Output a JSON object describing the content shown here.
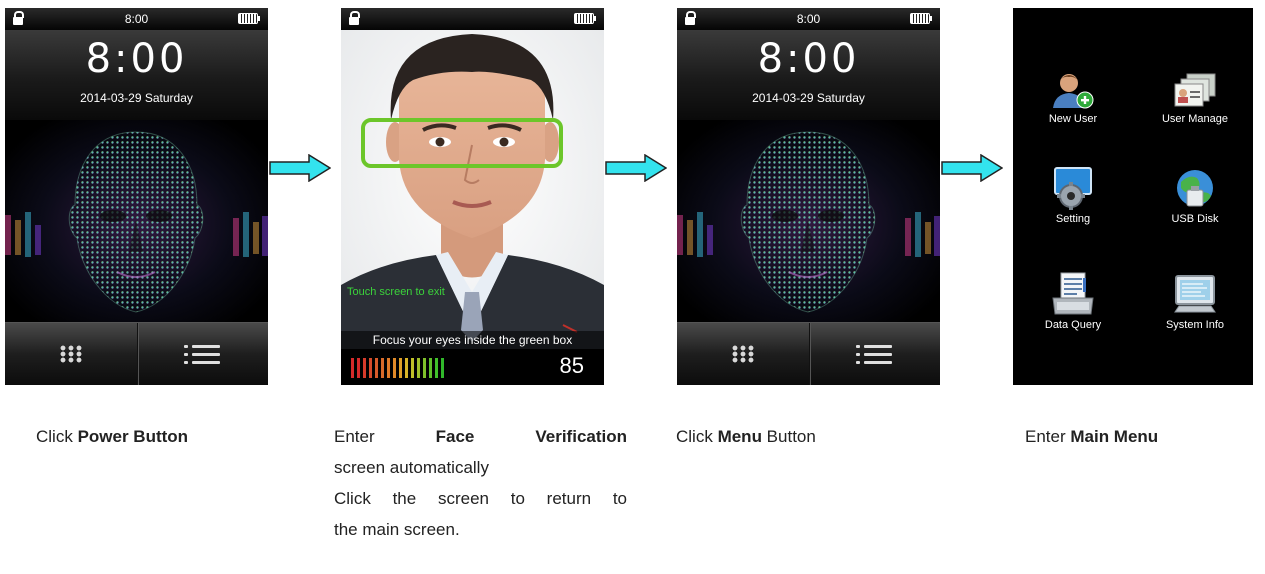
{
  "screens": {
    "lock": {
      "status_time": "8:00",
      "big_time": "8:00",
      "date": "2014-03-29  Saturday"
    },
    "verify": {
      "touch_hint": "Touch screen to exit",
      "focus_hint": "Focus your eyes inside the green box",
      "score": "85"
    },
    "menu": {
      "items": [
        {
          "label": "New User",
          "icon": "new-user-icon"
        },
        {
          "label": "User Manage",
          "icon": "user-manage-icon"
        },
        {
          "label": "Setting",
          "icon": "setting-icon"
        },
        {
          "label": "USB Disk",
          "icon": "usb-disk-icon"
        },
        {
          "label": "Data Query",
          "icon": "data-query-icon"
        },
        {
          "label": "System Info",
          "icon": "system-info-icon"
        }
      ]
    }
  },
  "colors": {
    "arrow_fill": "#33e3ee",
    "verify_box": "#6cc62a",
    "hint_green": "#3bd23b"
  },
  "captions": {
    "c1_pre": "Click ",
    "c1_bold": "Power Button",
    "c2_l1_a": "Enter",
    "c2_l1_b": "Face",
    "c2_l1_c": "Verification",
    "c2_l2": "screen automatically",
    "c2_l3": "Click the screen to return to",
    "c2_l4": "the main screen.",
    "c3_pre": "Click ",
    "c3_bold": "Menu",
    "c3_post": " Button",
    "c4_pre": "Enter ",
    "c4_bold": "Main Menu"
  }
}
